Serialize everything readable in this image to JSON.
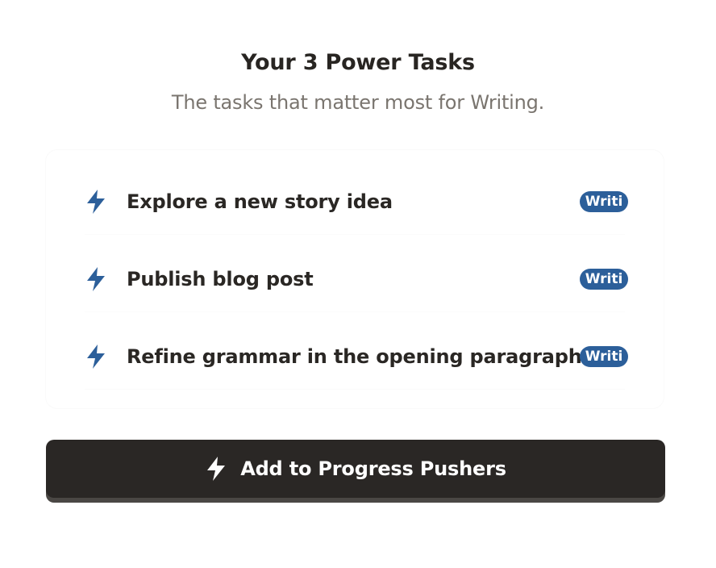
{
  "header": {
    "title": "Your 3 Power Tasks",
    "subtitle": "The tasks that matter most for Writing."
  },
  "tasks": [
    {
      "icon": "lightning-bolt-icon",
      "label": "Explore a new story idea",
      "badge": "Writi"
    },
    {
      "icon": "lightning-bolt-icon",
      "label": "Publish blog post",
      "badge": "Writi"
    },
    {
      "icon": "lightning-bolt-icon",
      "label": "Refine grammar in the opening paragraph",
      "badge": "Writi"
    }
  ],
  "add_button": {
    "icon": "lightning-bolt-icon",
    "label": "Add to Progress Pushers"
  },
  "colors": {
    "accent_blue": "#2c5f9a",
    "button_dark": "#2a2725",
    "title_text": "#282522",
    "subtitle_text": "#7a756f"
  }
}
